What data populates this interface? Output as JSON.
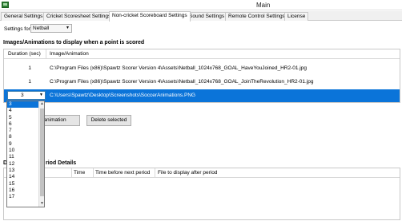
{
  "window": {
    "title": "Main"
  },
  "tabs": [
    {
      "label": "General Settings"
    },
    {
      "label": "Cricket Scoresheet Settings"
    },
    {
      "label": "Non-cricket Scoreboard Settings"
    },
    {
      "label": "Sound Settings"
    },
    {
      "label": "Remote Control Settings"
    },
    {
      "label": "License"
    }
  ],
  "settings_for": {
    "label": "Settings for:",
    "value": "Netball"
  },
  "images_section": {
    "title": "Images/Animations to display when a point is scored",
    "columns": [
      "Duration (sec)",
      "Image/Animation"
    ],
    "rows": [
      {
        "duration": "1",
        "image": "C:\\Program Files (x86)\\Spawtz Scorer Version 4\\Assets\\Netball_1024x768_GOAL_HaveYouJoined_HR2-01.jpg"
      },
      {
        "duration": "1",
        "image": "C:\\Program Files (x86)\\Spawtz Scorer Version 4\\Assets\\Netball_1024x768_GOAL_JoinTheRevolution_HR2-01.jpg"
      },
      {
        "duration": "3",
        "image": "C:\\Users\\Spawtz\\Desktop\\Screenshots\\SoccerAnimations.PNG"
      }
    ]
  },
  "buttons": {
    "add_partial": "e/animation",
    "delete": "Delete selected"
  },
  "dropdown": {
    "options": [
      "3",
      "4",
      "5",
      "6",
      "7",
      "8",
      "9",
      "10",
      "11",
      "12",
      "13",
      "14",
      "15",
      "16",
      "17"
    ],
    "selected": "3"
  },
  "period_section": {
    "title_start": "D",
    "title_end": "riod Details",
    "columns": [
      "Time",
      "Time before next period",
      "File to display after period"
    ]
  },
  "colors": {
    "selection": "#0b74d9"
  }
}
